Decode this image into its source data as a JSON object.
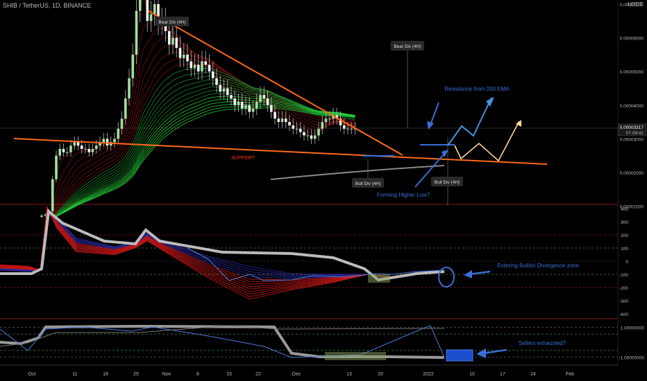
{
  "header": {
    "symbol_title": "SHIB / TetherUS, 1D, BINANCE",
    "quote_unit": "USDT"
  },
  "price_axis": {
    "labels": [
      "0.00009000",
      "0.00008000",
      "0.00007000",
      "0.00006000",
      "0.00005000",
      "0.00004000",
      "0.00003000",
      "0.00002000",
      "0.00001000"
    ],
    "current_price": "0.00003317",
    "countdown": "07:09:42"
  },
  "osc1_axis": {
    "labels": [
      "400",
      "300",
      "200",
      "100",
      "0",
      "-100",
      "-200",
      "-300",
      "-400"
    ]
  },
  "osc2_axis": {
    "labels": [
      "1.00000000",
      "-1.00000000"
    ]
  },
  "time_axis": {
    "labels": [
      "Oct",
      "11",
      "18",
      "25",
      "Nov",
      "8",
      "15",
      "22",
      "Dec",
      "13",
      "20",
      "2022",
      "10",
      "17",
      "24",
      "Feb"
    ]
  },
  "annotations": {
    "bear_div_1": "Bear Div (4H)",
    "bear_div_2": "Bear Div (4H)",
    "bull_div_1": "Bull Div (4H)",
    "bull_div_2": "Bull Div (4H)",
    "support": "SUPPORT",
    "resistance": "Resistance from 200 EMA",
    "higher_low": "Forming Higher Low?",
    "bullish_zone": "Entering Bullish Divergence zone",
    "sellers": "Sellers exhausted?"
  },
  "colors": {
    "up": "#c8c8c8",
    "down": "#ffffff",
    "trendline": "#ff6a1a",
    "projection_blue": "#4a90e2",
    "projection_orange": "#ffd89a",
    "annotation_blue": "#3a6fd8",
    "ema_green": "#2ecc40",
    "ema_red": "#e02020"
  },
  "chart_data": {
    "type": "candlestick",
    "symbol": "SHIB/USDT",
    "interval": "1D",
    "exchange": "BINANCE",
    "date_range": [
      "2021-10-01",
      "2022-01-06"
    ],
    "ylim": [
      1e-05,
      9e-05
    ],
    "approx_closes": [
      7.2e-06,
      7.5e-06,
      8.5e-06,
      1.8e-05,
      2.5e-05,
      2.7e-05,
      2.6e-05,
      2.6e-05,
      2.8e-05,
      2.9e-05,
      2.8e-05,
      2.7e-05,
      2.7e-05,
      2.6e-05,
      2.7e-05,
      2.8e-05,
      2.9e-05,
      3e-05,
      2.8e-05,
      2.9e-05,
      3e-05,
      3.3e-05,
      3.6e-05,
      4.2e-05,
      4.8e-05,
      5.5e-05,
      6.8e-05,
      8e-05,
      7.5e-05,
      6.5e-05,
      6.7e-05,
      7e-05,
      6.4e-05,
      6.5e-05,
      6.2e-05,
      5.8e-05,
      6e-05,
      5.7e-05,
      5.4e-05,
      5.5e-05,
      5.3e-05,
      5.1e-05,
      5.2e-05,
      5e-05,
      5.3e-05,
      5.2e-05,
      5e-05,
      4.8e-05,
      4.6e-05,
      4.4e-05,
      4.5e-05,
      4.3e-05,
      4.2e-05,
      4e-05,
      4.1e-05,
      3.9e-05,
      4e-05,
      3.8e-05,
      3.9e-05,
      4.1e-05,
      4.3e-05,
      4.2e-05,
      4e-05,
      3.8e-05,
      3.6e-05,
      3.5e-05,
      3.6e-05,
      3.5e-05,
      3.4e-05,
      3.3e-05,
      3.3e-05,
      3.2e-05,
      3.1e-05,
      3.1e-05,
      3e-05,
      3.1e-05,
      3.3e-05,
      3.5e-05,
      3.6e-05,
      3.6e-05,
      3.7e-05,
      3.6e-05,
      3.4e-05,
      3.3e-05,
      3.3e-05,
      3.3e-05,
      3.3e-05
    ]
  }
}
